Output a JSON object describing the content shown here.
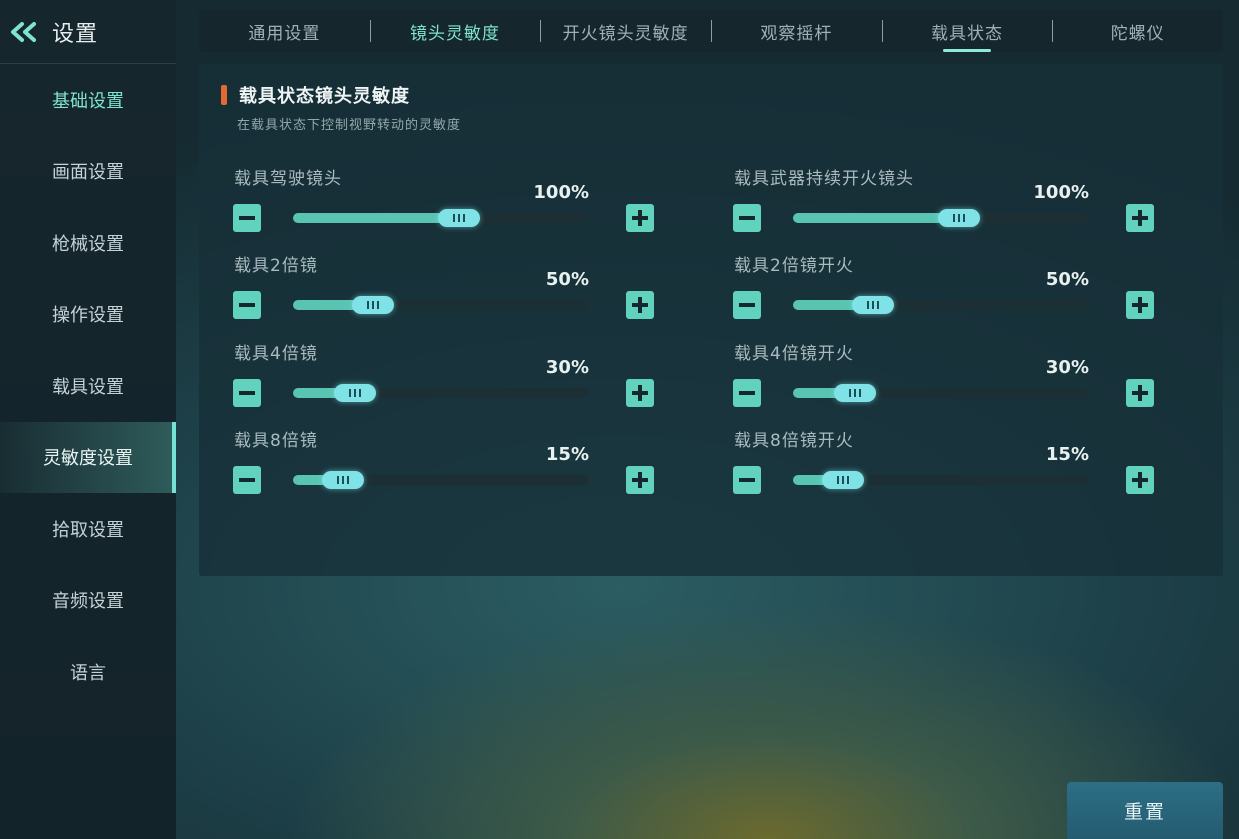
{
  "sidebar": {
    "title": "设置",
    "back_icon": "double-chevron-left-icon",
    "items": [
      {
        "label": "基础设置"
      },
      {
        "label": "画面设置"
      },
      {
        "label": "枪械设置"
      },
      {
        "label": "操作设置"
      },
      {
        "label": "载具设置"
      },
      {
        "label": "灵敏度设置"
      },
      {
        "label": "拾取设置"
      },
      {
        "label": "音频设置"
      },
      {
        "label": "语言"
      }
    ],
    "active_index": 5
  },
  "tabs": [
    {
      "label": "通用设置"
    },
    {
      "label": "镜头灵敏度"
    },
    {
      "label": "开火镜头灵敏度"
    },
    {
      "label": "观察摇杆"
    },
    {
      "label": "载具状态"
    },
    {
      "label": "陀螺仪"
    }
  ],
  "section": {
    "title": "载具状态镜头灵敏度",
    "subtitle": "在载具状态下控制视野转动的灵敏度",
    "accent_color": "#e46a33"
  },
  "sliders": {
    "left": [
      {
        "label": "载具驾驶镜头",
        "value_text": "100%",
        "level": 0.56
      },
      {
        "label": "载具2倍镜",
        "value_text": "50%",
        "level": 0.27
      },
      {
        "label": "载具4倍镜",
        "value_text": "30%",
        "level": 0.21
      },
      {
        "label": "载具8倍镜",
        "value_text": "15%",
        "level": 0.17
      }
    ],
    "right": [
      {
        "label": "载具武器持续开火镜头",
        "value_text": "100%",
        "level": 0.56
      },
      {
        "label": "载具2倍镜开火",
        "value_text": "50%",
        "level": 0.27
      },
      {
        "label": "载具4倍镜开火",
        "value_text": "30%",
        "level": 0.21
      },
      {
        "label": "载具8倍镜开火",
        "value_text": "15%",
        "level": 0.17
      }
    ]
  },
  "reset_button": {
    "label": "重置"
  },
  "colors": {
    "accent": "#61d2bd",
    "active_text": "#7fe4cf"
  }
}
